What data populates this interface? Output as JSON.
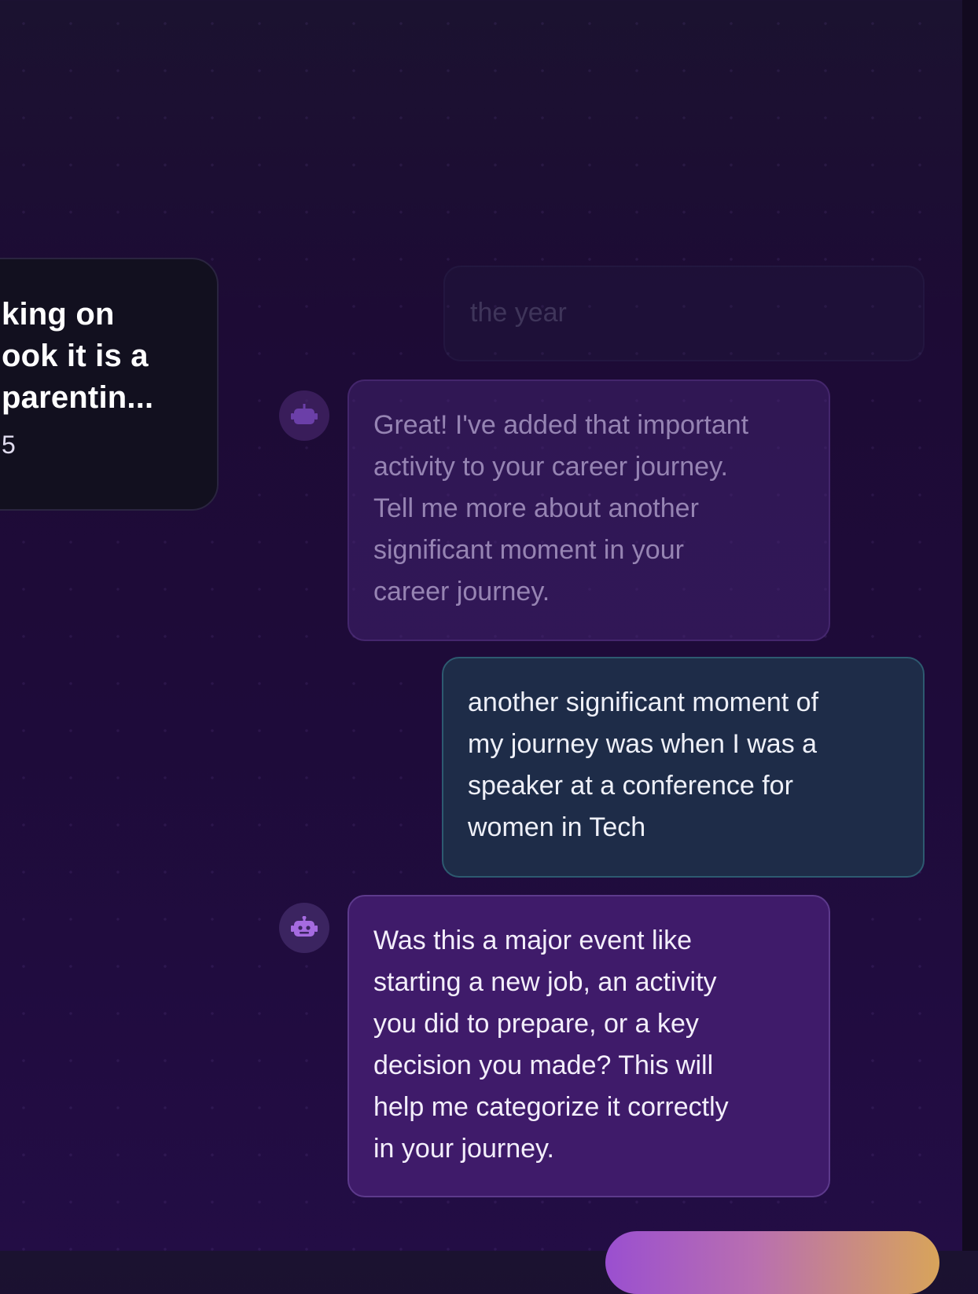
{
  "card": {
    "title_lines": [
      "king on",
      "ook it is a",
      "parentin..."
    ],
    "meta": "5"
  },
  "messages": {
    "faded_user": {
      "lines": [
        "the year"
      ]
    },
    "bot_1": {
      "lines": [
        "Great! I've added that important",
        "activity to your career journey.",
        "Tell me more about another",
        "significant moment in your",
        "career journey."
      ]
    },
    "user_1": {
      "lines": [
        "another significant moment of",
        "my journey was when I was a",
        "speaker at a conference for",
        "women in Tech"
      ]
    },
    "bot_2": {
      "lines": [
        "Was this a major event like",
        "starting a new job, an activity",
        "you did to prepare, or a key",
        "decision you made? This will",
        "help me categorize it correctly",
        "in your journey."
      ]
    }
  },
  "icons": {
    "avatar": "robot-icon"
  },
  "colors": {
    "accent": "#8b5cf6",
    "user_border": "#2d5a70",
    "bot_bubble": "#3f1b6a"
  }
}
